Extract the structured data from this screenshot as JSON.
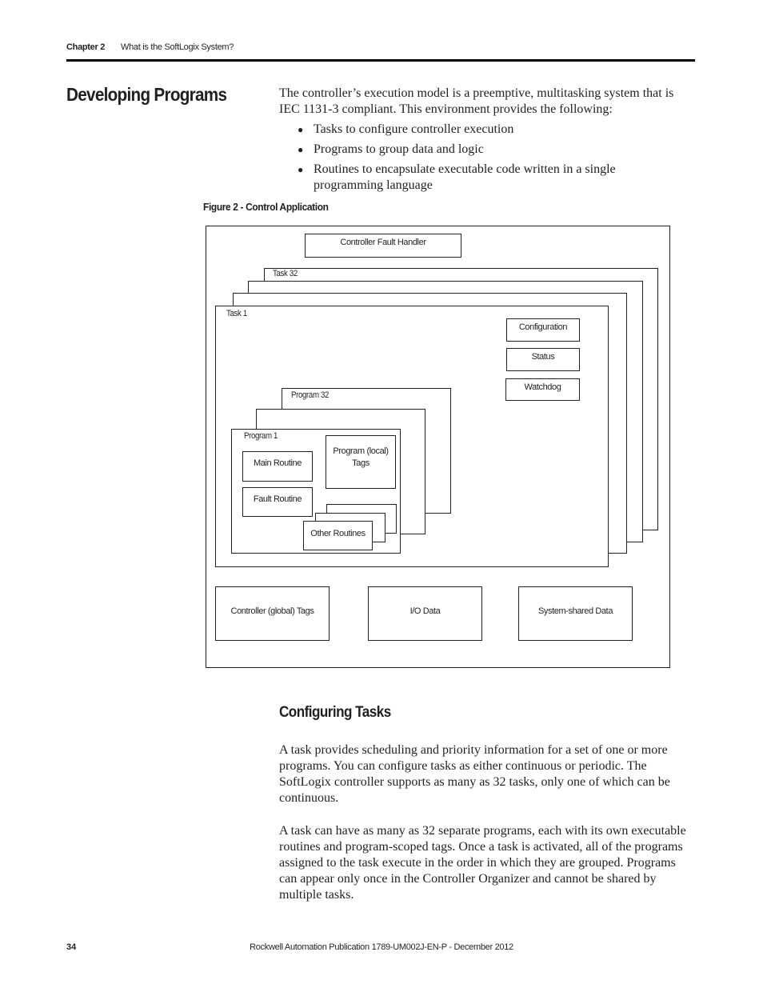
{
  "header": {
    "chapter": "Chapter 2",
    "chapter_title": "What is the SoftLogix System?"
  },
  "section": {
    "title": "Developing Programs",
    "intro": "The controller’s execution model is a preemptive, multitasking system that is IEC 1131-3 compliant. This environment provides the following:",
    "bullets": [
      "Tasks to configure controller execution",
      "Programs to group data and logic",
      "Routines to encapsulate executable code written in a single programming language"
    ]
  },
  "figure": {
    "caption": "Figure 2 - Control Application",
    "fault_handler": "Controller Fault Handler",
    "task_last": "Task 32",
    "task_first": "Task 1",
    "task_items": [
      "Configuration",
      "Status",
      "Watchdog"
    ],
    "program_last": "Program 32",
    "program_first": "Program 1",
    "main_routine": "Main Routine",
    "fault_routine": "Fault Routine",
    "local_tags": "Program (local) Tags",
    "other_routines": "Other Routines",
    "bottom_boxes": [
      "Controller (global) Tags",
      "I/O Data",
      "System-shared Data"
    ]
  },
  "subsection": {
    "title": "Configuring Tasks",
    "paragraphs": [
      "A task provides scheduling and priority information for a set of one or more programs. You can configure tasks as either continuous or periodic. The SoftLogix controller supports as many as 32 tasks, only one of which can be continuous.",
      "A task can have as many as 32 separate programs, each with its own executable routines and program-scoped tags. Once a task is activated, all of the programs assigned to the task execute in the order in which they are grouped. Programs can appear only once in the Controller Organizer and cannot be shared by multiple tasks."
    ]
  },
  "footer": {
    "page_number": "34",
    "publication": "Rockwell Automation Publication 1789-UM002J-EN-P - December 2012"
  }
}
